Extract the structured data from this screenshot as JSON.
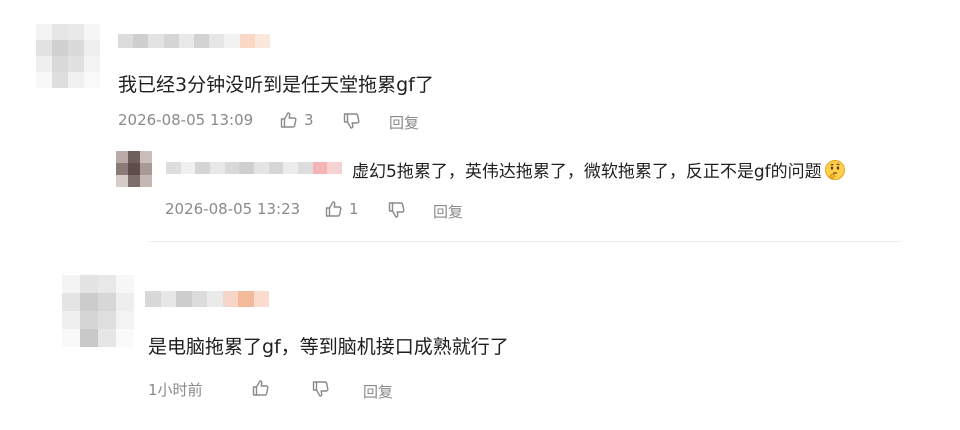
{
  "comments": [
    {
      "text": "我已经3分钟没听到是任天堂拖累gf了",
      "time": "2026-08-05 13:09",
      "likes": "3",
      "reply_label": "回复",
      "replies": [
        {
          "text": "虚幻5拖累了，英伟达拖累了，微软拖累了，反正不是gf的问题",
          "emoji": "thinking-face-icon",
          "time": "2026-08-05 13:23",
          "likes": "1",
          "reply_label": "回复"
        }
      ]
    },
    {
      "text": "是电脑拖累了gf，等到脑机接口成熟就行了",
      "time": "1小时前",
      "likes": "",
      "reply_label": "回复"
    }
  ],
  "colors": {
    "meta": "#8a8a8a",
    "text": "#1f1f1f",
    "divider": "#ececec",
    "blur_gray": "#dcdcdc",
    "blur_orange": "#f8c8a8"
  }
}
